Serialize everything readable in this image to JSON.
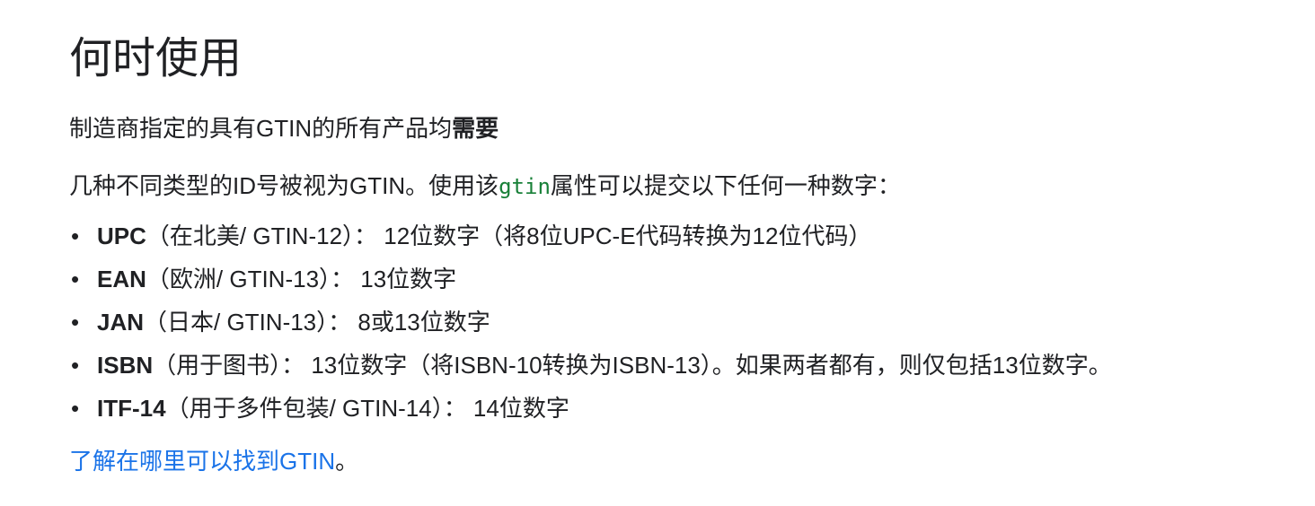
{
  "title": "何时使用",
  "required_text_prefix": "制造商指定的具有GTIN的所有产品均",
  "required_text_bold": "需要",
  "intro_prefix": "几种不同类型的ID号被视为GTIN。使用该",
  "intro_code": "gtin",
  "intro_suffix": "属性可以提交以下任何一种数字：",
  "bullet_glyph": "•",
  "items": [
    {
      "name": "UPC",
      "desc": "（在北美/ GTIN-12）： 12位数字（将8位UPC-E代码转换为12位代码）"
    },
    {
      "name": "EAN",
      "desc": "（欧洲/ GTIN-13）： 13位数字"
    },
    {
      "name": "JAN",
      "desc": "（日本/ GTIN-13）： 8或13位数字"
    },
    {
      "name": "ISBN",
      "desc": "（用于图书）： 13位数字（将ISBN-10转换为ISBN-13）。如果两者都有，则仅包括13位数字。"
    },
    {
      "name": "ITF-14",
      "desc": "（用于多件包装/ GTIN-14）： 14位数字"
    }
  ],
  "link_text": "了解在哪里可以找到GTIN",
  "link_suffix": "。",
  "colors": {
    "text": "#202124",
    "link": "#1a73e8",
    "code": "#188038"
  }
}
